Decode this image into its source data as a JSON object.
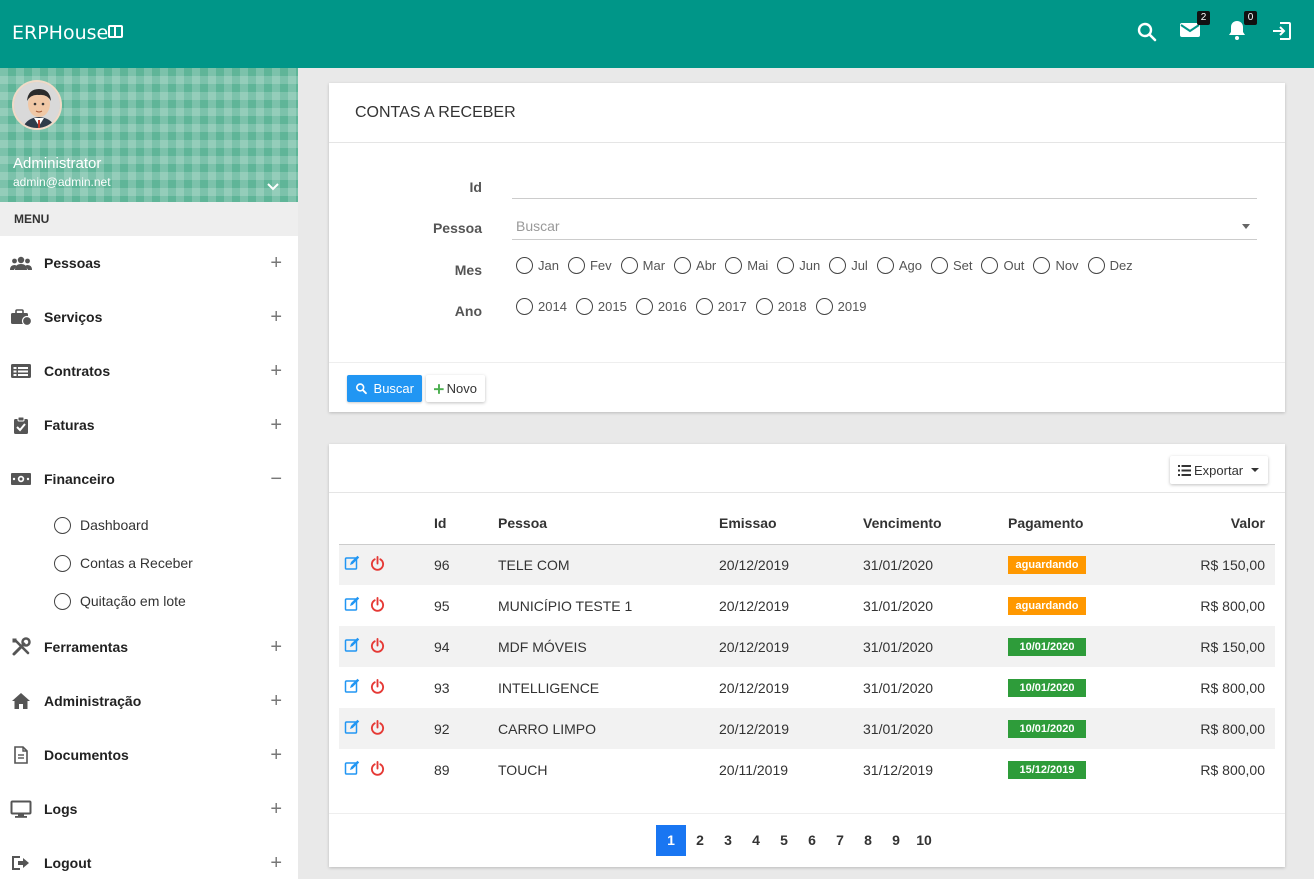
{
  "app": {
    "title": "ERPHouse"
  },
  "topbar": {
    "mail_count": "2",
    "notif_count": "0"
  },
  "user": {
    "name": "Administrator",
    "email": "admin@admin.net"
  },
  "sidebar": {
    "menu_label": "MENU",
    "items": [
      {
        "label": "Pessoas",
        "toggle": "+"
      },
      {
        "label": "Serviços",
        "toggle": "+"
      },
      {
        "label": "Contratos",
        "toggle": "+"
      },
      {
        "label": "Faturas",
        "toggle": "+"
      },
      {
        "label": "Financeiro",
        "toggle": "−"
      },
      {
        "label": "Ferramentas",
        "toggle": "+"
      },
      {
        "label": "Administração",
        "toggle": "+"
      },
      {
        "label": "Documentos",
        "toggle": "+"
      },
      {
        "label": "Logs",
        "toggle": "+"
      },
      {
        "label": "Logout",
        "toggle": "+"
      }
    ],
    "financeiro_sub": [
      "Dashboard",
      "Contas a Receber",
      "Quitação em lote"
    ]
  },
  "filter": {
    "title": "CONTAS A RECEBER",
    "id_label": "Id",
    "id_value": "",
    "pessoa_label": "Pessoa",
    "pessoa_placeholder": "Buscar",
    "mes_label": "Mes",
    "months": [
      "Jan",
      "Fev",
      "Mar",
      "Abr",
      "Mai",
      "Jun",
      "Jul",
      "Ago",
      "Set",
      "Out",
      "Nov",
      "Dez"
    ],
    "ano_label": "Ano",
    "years": [
      "2014",
      "2015",
      "2016",
      "2017",
      "2018",
      "2019"
    ],
    "search_button": "Buscar",
    "new_button": "Novo"
  },
  "list": {
    "export_button": "Exportar",
    "columns": [
      "Id",
      "Pessoa",
      "Emissao",
      "Vencimento",
      "Pagamento",
      "Valor"
    ],
    "rows": [
      {
        "id": "96",
        "pessoa": "TELE COM",
        "emissao": "20/12/2019",
        "vencimento": "31/01/2020",
        "pagamento": "aguardando",
        "status": "wait",
        "valor": "R$ 150,00"
      },
      {
        "id": "95",
        "pessoa": "MUNICÍPIO TESTE 1",
        "emissao": "20/12/2019",
        "vencimento": "31/01/2020",
        "pagamento": "aguardando",
        "status": "wait",
        "valor": "R$ 800,00"
      },
      {
        "id": "94",
        "pessoa": "MDF MÓVEIS",
        "emissao": "20/12/2019",
        "vencimento": "31/01/2020",
        "pagamento": "10/01/2020",
        "status": "paid",
        "valor": "R$ 150,00"
      },
      {
        "id": "93",
        "pessoa": "INTELLIGENCE",
        "emissao": "20/12/2019",
        "vencimento": "31/01/2020",
        "pagamento": "10/01/2020",
        "status": "paid",
        "valor": "R$ 800,00"
      },
      {
        "id": "92",
        "pessoa": "CARRO LIMPO",
        "emissao": "20/12/2019",
        "vencimento": "31/01/2020",
        "pagamento": "10/01/2020",
        "status": "paid",
        "valor": "R$ 800,00"
      },
      {
        "id": "89",
        "pessoa": "TOUCH",
        "emissao": "20/11/2019",
        "vencimento": "31/12/2019",
        "pagamento": "15/12/2019",
        "status": "paid",
        "valor": "R$ 800,00"
      }
    ],
    "pages": [
      "1",
      "2",
      "3",
      "4",
      "5",
      "6",
      "7",
      "8",
      "9",
      "10"
    ],
    "current_page": "1"
  },
  "colors": {
    "primary": "#009688",
    "accent": "#2196f3",
    "wait": "#ff9800",
    "paid": "#2e9c3a",
    "danger": "#e53935"
  }
}
